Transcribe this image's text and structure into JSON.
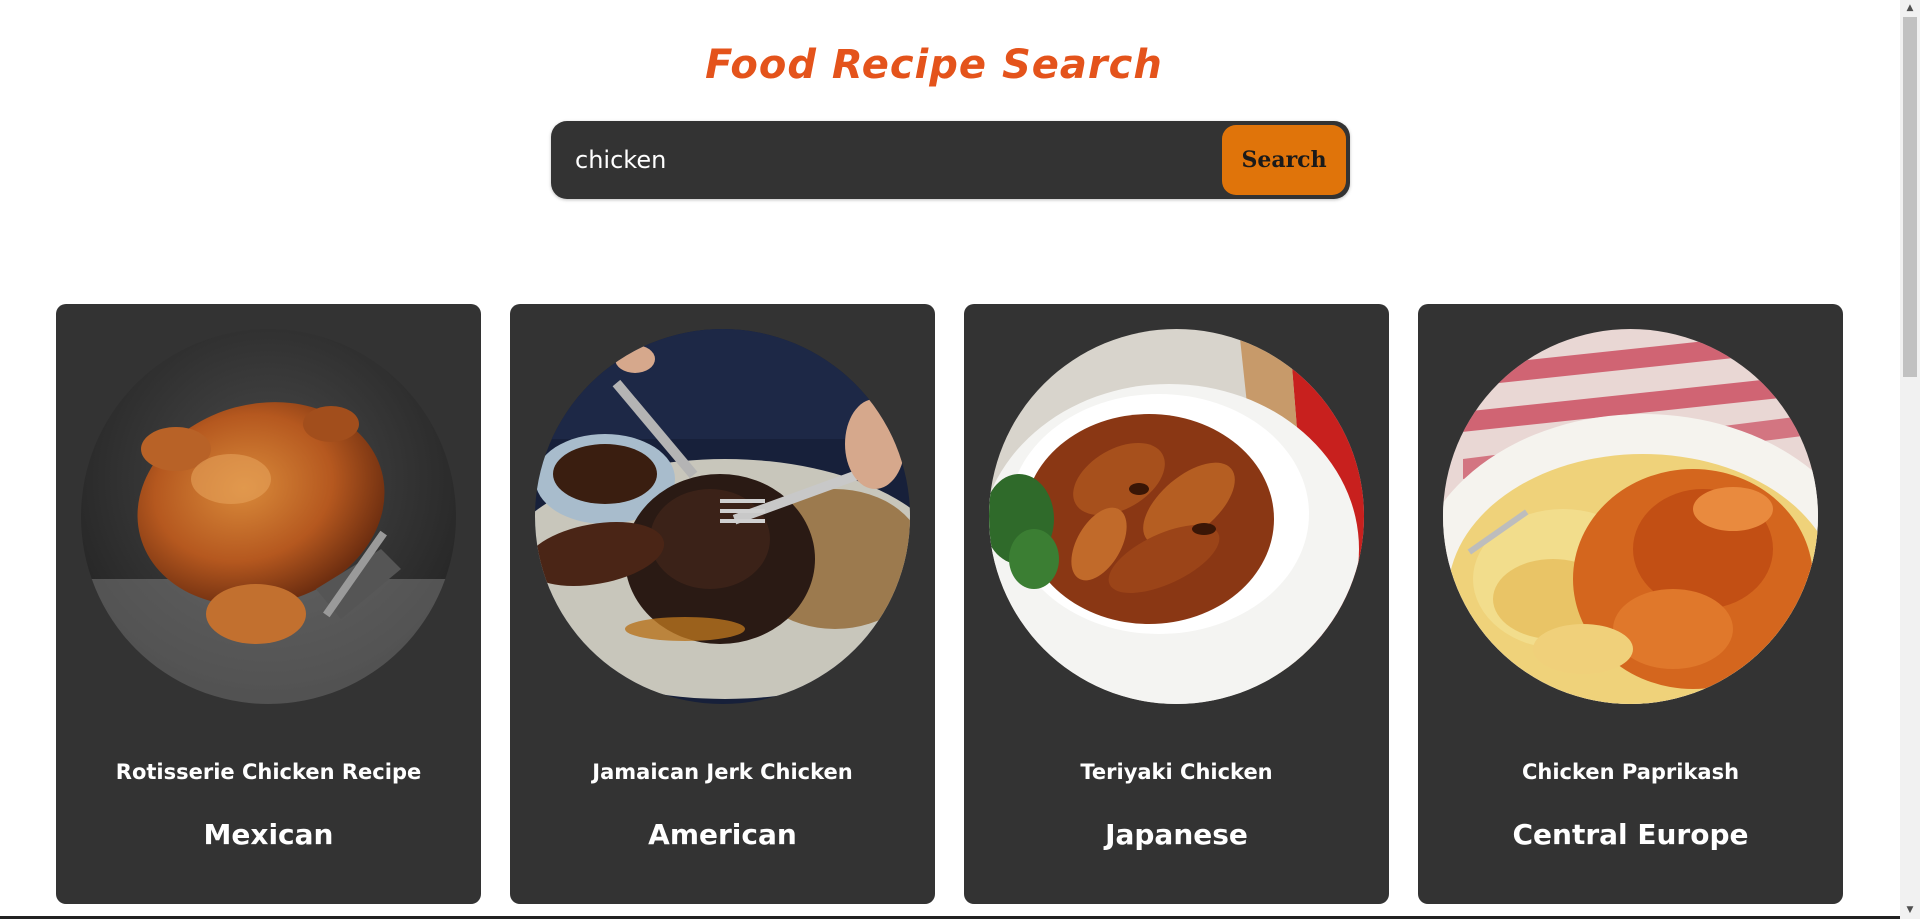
{
  "header": {
    "title": "Food Recipe Search"
  },
  "search": {
    "value": "chicken",
    "button_label": "Search"
  },
  "results": [
    {
      "name": "Rotisserie Chicken Recipe",
      "area": "Mexican",
      "image": "rotisserie-chicken-photo"
    },
    {
      "name": "Jamaican Jerk Chicken",
      "area": "American",
      "image": "jerk-chicken-photo"
    },
    {
      "name": "Teriyaki Chicken",
      "area": "Japanese",
      "image": "teriyaki-chicken-photo"
    },
    {
      "name": "Chicken Paprikash",
      "area": "Central Europe",
      "image": "chicken-paprikash-photo"
    }
  ],
  "colors": {
    "title": "#e4531b",
    "search_bar": "#333333",
    "search_button": "#e0740a",
    "card": "#333333"
  },
  "scrollbar": {
    "up_icon": "triangle-up-icon",
    "down_icon": "triangle-down-icon"
  }
}
